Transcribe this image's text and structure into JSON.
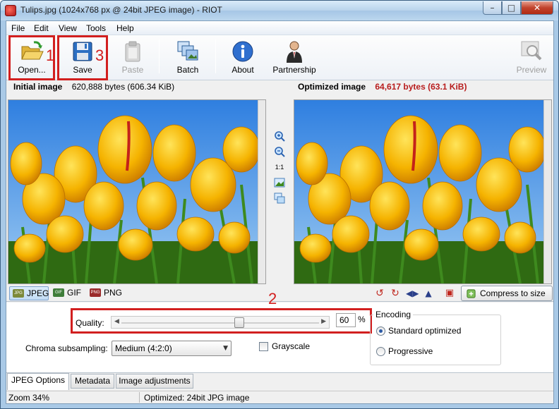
{
  "window": {
    "title": "Tulips.jpg (1024x768 px @ 24bit JPEG image) - RIOT",
    "minimize": "–",
    "maximize": "□",
    "close": "✕"
  },
  "menu": [
    "File",
    "Edit",
    "View",
    "Tools",
    "Help"
  ],
  "toolbar": {
    "open_label": "Open...",
    "save_label": "Save",
    "paste_label": "Paste",
    "batch_label": "Batch",
    "about_label": "About",
    "partnership_label": "Partnership",
    "preview_label": "Preview",
    "icons": {
      "open": "folder-open-icon",
      "save": "floppy-disk-icon",
      "paste": "clipboard-icon",
      "batch": "batch-images-icon",
      "about": "info-icon",
      "partnership": "person-icon",
      "preview": "magnifier-icon"
    }
  },
  "annotations": {
    "open_number": "1",
    "save_number": "3",
    "quality_number": "2",
    "color": "#d21f1f"
  },
  "initial": {
    "label": "Initial image",
    "bytes": "620,888 bytes (606.34 KiB)"
  },
  "optimized": {
    "label": "Optimized image",
    "bytes": "64,617 bytes (63.1 KiB)",
    "bytes_color": "#b81d1d"
  },
  "zoom_tools": {
    "zoom_in": "zoom-in-icon",
    "zoom_out": "zoom-out-icon",
    "actual_size": "1:1",
    "fit": "fit-image-icon",
    "compare": "compare-icon"
  },
  "formats": {
    "jpeg": "JPEG",
    "gif": "GIF",
    "png": "PNG",
    "selected": "JPEG"
  },
  "compress_label": "Compress to size",
  "options": {
    "quality_label": "Quality:",
    "quality_value": "60",
    "quality_unit": "%",
    "quality_level": 0.6,
    "chroma_label": "Chroma subsampling:",
    "chroma_value": "Medium (4:2:0)",
    "grayscale_label": "Grayscale",
    "grayscale_checked": false,
    "encoding_title": "Encoding",
    "encoding_standard": "Standard optimized",
    "encoding_progressive": "Progressive",
    "encoding_selected": "Standard optimized"
  },
  "bottom_tabs": [
    "JPEG Options",
    "Metadata",
    "Image adjustments"
  ],
  "status": {
    "zoom": "Zoom 34%",
    "info": "Optimized: 24bit JPG image"
  }
}
